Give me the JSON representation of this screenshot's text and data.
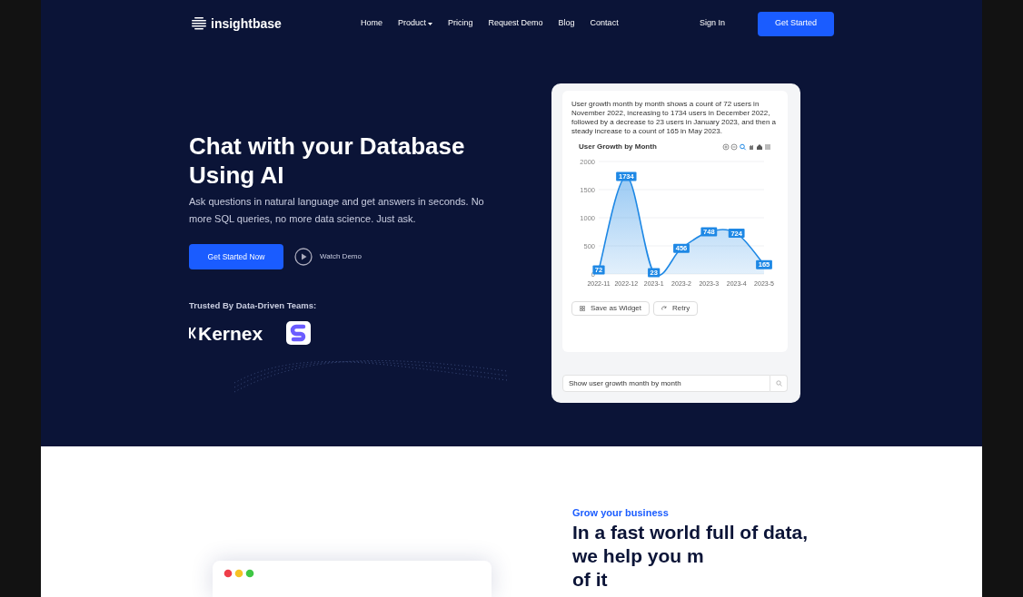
{
  "nav": {
    "brand": "insightbase",
    "links": [
      {
        "label": "Home",
        "dropdown": false
      },
      {
        "label": "Product",
        "dropdown": true
      },
      {
        "label": "Pricing",
        "dropdown": false
      },
      {
        "label": "Request Demo",
        "dropdown": false
      },
      {
        "label": "Blog",
        "dropdown": false
      },
      {
        "label": "Contact",
        "dropdown": false
      }
    ],
    "sign_in": "Sign In",
    "cta": "Get Started"
  },
  "hero": {
    "title_lines": [
      "Chat with your Database",
      "Using AI"
    ],
    "subtitle": "Ask questions in natural language and get answers in seconds. No more SQL queries, no more data science. Just ask.",
    "primary_button": "Get Started Now",
    "secondary_button": "Watch Demo",
    "trusted_label": "Trusted By Data-Driven Teams:",
    "logos": [
      {
        "kind": "wordmark",
        "text": "Kernex"
      },
      {
        "kind": "mark"
      }
    ]
  },
  "chat_card": {
    "answer": "User growth month by month shows a count of 72 users in November 2022, increasing to 1734 users in December 2022, followed by a decrease to 23 users in January 2023, and then a steady increase to a count of 165 in May 2023.",
    "chart_data": {
      "type": "area",
      "title": "User Growth by Month",
      "categories": [
        "2022-11",
        "2022-12",
        "2023-1",
        "2023-2",
        "2023-3",
        "2023-4",
        "2023-5"
      ],
      "series": [
        {
          "color": "#1e88e5",
          "values": [
            72,
            1734,
            23,
            456,
            748,
            724,
            165
          ]
        }
      ],
      "ylim": [
        0,
        2000
      ],
      "yticks": [
        0,
        500,
        1000,
        1500,
        2000
      ],
      "grid": true,
      "data_labels": true
    },
    "actions": [
      "Save as Widget",
      "Retry"
    ],
    "query": "Show user growth month by month"
  },
  "section2": {
    "eyebrow": "Grow your business",
    "heading_lines": [
      "In a fast world full of data,",
      "we help you m",
      "of it"
    ]
  }
}
